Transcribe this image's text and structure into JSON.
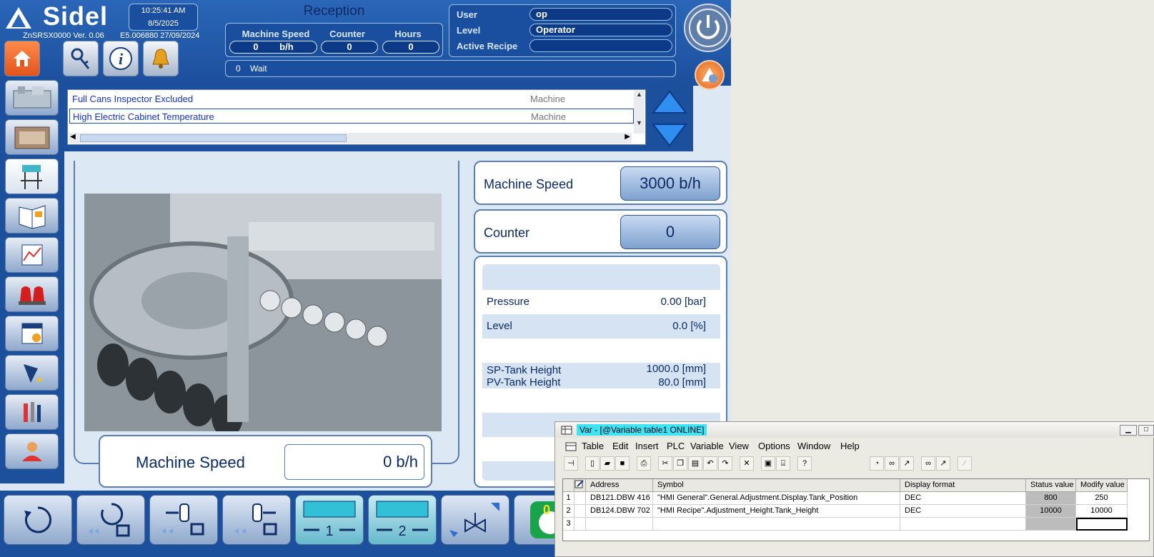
{
  "header": {
    "brand": "Sidel",
    "version": "ZnSRSX0000 Ver. 0.06",
    "build": "E5.006880 27/09/2024",
    "time": "10:25:41 AM",
    "date": "8/5/2025"
  },
  "reception": {
    "title": "Reception",
    "labels": {
      "speed": "Machine Speed",
      "counter": "Counter",
      "hours": "Hours"
    },
    "speed_value": "0",
    "speed_unit": "b/h",
    "counter_value": "0",
    "hours_value": "0"
  },
  "user": {
    "user_label": "User",
    "user_value": "op",
    "level_label": "Level",
    "level_value": "Operator",
    "recipe_label": "Active Recipe",
    "recipe_value": ""
  },
  "status": {
    "code": "0",
    "text": "Wait"
  },
  "alarms": [
    {
      "text": "Full Cans Inspector Excluded",
      "category": "Machine"
    },
    {
      "text": "High Electric Cabinet Temperature",
      "category": "Machine"
    }
  ],
  "machine_panel": {
    "speed_label": "Machine Speed",
    "speed_value": "0  b/h"
  },
  "right_panel": {
    "speed_label": "Machine Speed",
    "speed_value": "3000 b/h",
    "counter_label": "Counter",
    "counter_value": "0",
    "rows": [
      {
        "label": "Pressure",
        "value": "0.00 [bar]"
      },
      {
        "label": "Level",
        "value": "0.0 [%]"
      },
      {
        "label": "SP-Tank Height",
        "value": "1000.0 [mm]"
      },
      {
        "label": "PV-Tank Height",
        "value": "80.0 [mm]"
      }
    ]
  },
  "bottom_buttons": [
    {
      "icon": "cycle-icon"
    },
    {
      "icon": "cycle-stop-icon"
    },
    {
      "icon": "transfer-reverse-icon"
    },
    {
      "icon": "transfer-forward-icon"
    },
    {
      "icon": "station-1-icon",
      "label": "1"
    },
    {
      "icon": "station-2-icon",
      "label": "2"
    },
    {
      "icon": "valve-icon"
    },
    {
      "icon": "hand-mode-icon",
      "label": "0"
    }
  ],
  "var_window": {
    "title": "Var - [@Variable table1  ONLINE]",
    "menu": [
      "Table",
      "Edit",
      "Insert",
      "PLC",
      "Variable",
      "View",
      "Options",
      "Window",
      "Help"
    ],
    "columns": [
      "Address",
      "Symbol",
      "Display format",
      "Status value",
      "Modify value"
    ],
    "rows": [
      {
        "n": "1",
        "address": "DB121.DBW  416",
        "symbol": "\"HMI General\".General.Adjustment.Display.Tank_Position",
        "format": "DEC",
        "status": "800",
        "modify": "250"
      },
      {
        "n": "2",
        "address": "DB124.DBW  702",
        "symbol": "\"HMI Recipe\".Adjustment_Height.Tank_Height",
        "format": "DEC",
        "status": "10000",
        "modify": "10000"
      },
      {
        "n": "3",
        "address": "",
        "symbol": "",
        "format": "",
        "status": "",
        "modify": ""
      }
    ]
  },
  "colors": {
    "hmi_blue": "#1c4f9c",
    "accent_orange": "#e2541b",
    "highlight_cyan": "#41e4ee"
  }
}
